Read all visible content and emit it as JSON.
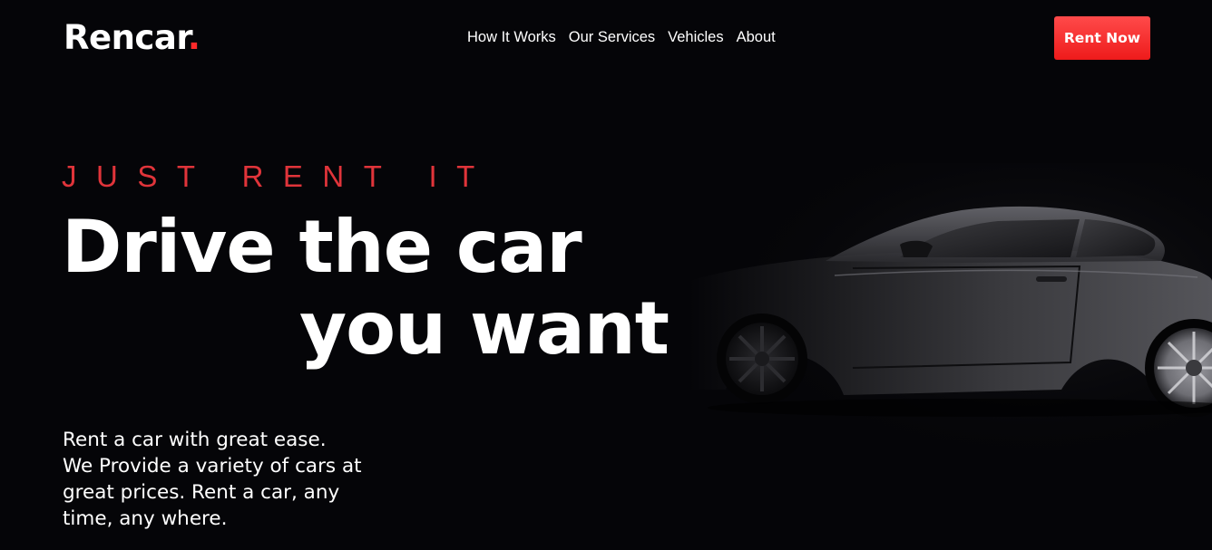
{
  "brand": {
    "name": "Rencar",
    "dot": "."
  },
  "nav": {
    "items": [
      {
        "label": "How It Works"
      },
      {
        "label": "Our Services"
      },
      {
        "label": "Vehicles"
      },
      {
        "label": "About"
      }
    ]
  },
  "header": {
    "cta_label": "Rent Now"
  },
  "hero": {
    "eyebrow": "JUST RENT IT",
    "headline_line1": "Drive the car",
    "headline_line2": "you want",
    "tagline": "Rent a car with great ease. We Provide a variety of cars at great prices. Rent a car, any time, any where."
  },
  "colors": {
    "background": "#050508",
    "accent": "#ff2a2a",
    "text": "#ffffff"
  }
}
